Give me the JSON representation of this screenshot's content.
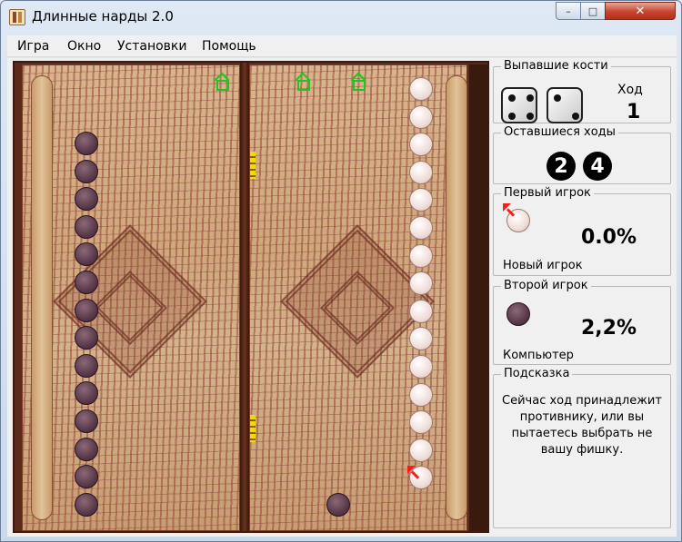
{
  "window": {
    "title": "Длинные нарды 2.0",
    "minimize_glyph": "–",
    "maximize_glyph": "□",
    "close_glyph": "✕"
  },
  "menu": [
    "Игра",
    "Окно",
    "Установки",
    "Помощь"
  ],
  "dice_panel": {
    "title": "Выпавшие кости",
    "dice": [
      4,
      2
    ],
    "turn_label": "Ход",
    "turn_value": "1"
  },
  "moves_panel": {
    "title": "Оставшиеся ходы",
    "moves": [
      "2",
      "4"
    ]
  },
  "player1": {
    "title": "Первый игрок",
    "percent": "0.0%",
    "name": "Новый игрок",
    "checker": "light"
  },
  "player2": {
    "title": "Второй игрок",
    "percent": "2,2%",
    "name": "Компьютер",
    "checker": "dark"
  },
  "hint": {
    "title": "Подсказка",
    "text": "Сейчас ход принадлежит противнику, или вы пытаетесь выбрать не вашу фишку."
  },
  "board": {
    "dark_stack_count": 14,
    "light_stack_count": 15,
    "dark_loose_count": 1
  },
  "colors": {
    "dark_checker": "#5a3a4a",
    "light_checker": "#f0ddd8",
    "house_marker": "#1fc41f",
    "point_marker": "#f5d800",
    "selection_arrow": "#ff1a1a"
  }
}
